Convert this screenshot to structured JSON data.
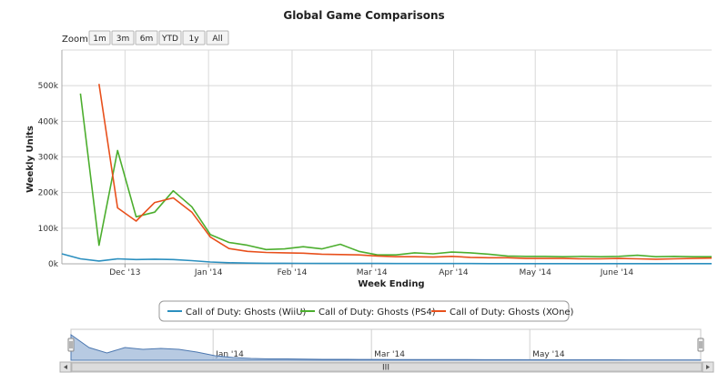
{
  "chart_data": {
    "type": "line",
    "title": "Global Game Comparisons",
    "xlabel": "Week Ending",
    "ylabel": "Weekly Units",
    "y_ticks": [
      "0k",
      "100k",
      "200k",
      "300k",
      "400k",
      "500k"
    ],
    "ylim": [
      0,
      600000
    ],
    "x_ticks": [
      "Dec '13",
      "Jan '14",
      "Feb '14",
      "Mar '14",
      "Apr '14",
      "May '14",
      "June '14"
    ],
    "x_tick_positions": [
      3.4,
      7.9,
      12.4,
      16.7,
      21.1,
      25.5,
      29.9
    ],
    "xlim": [
      0,
      35
    ],
    "grid": true,
    "legend_position": "bottom",
    "series": [
      {
        "name": "Call of Duty: Ghosts (WiiU)",
        "color": "#2b8fbf",
        "points": [
          [
            0,
            28000
          ],
          [
            1,
            14000
          ],
          [
            2,
            8000
          ],
          [
            3,
            14000
          ],
          [
            4,
            12000
          ],
          [
            5,
            13000
          ],
          [
            6,
            12000
          ],
          [
            7,
            9000
          ],
          [
            8,
            5000
          ],
          [
            9,
            3000
          ],
          [
            10,
            2000
          ],
          [
            11,
            1500
          ],
          [
            12,
            1500
          ],
          [
            13,
            1200
          ],
          [
            14,
            1000
          ],
          [
            15,
            1000
          ],
          [
            16,
            900
          ],
          [
            17,
            900
          ],
          [
            18,
            800
          ],
          [
            19,
            800
          ],
          [
            20,
            700
          ],
          [
            21,
            700
          ],
          [
            22,
            700
          ],
          [
            23,
            600
          ],
          [
            24,
            600
          ],
          [
            25,
            600
          ],
          [
            26,
            500
          ],
          [
            27,
            500
          ],
          [
            28,
            500
          ],
          [
            29,
            500
          ],
          [
            30,
            500
          ],
          [
            31,
            400
          ],
          [
            32,
            400
          ],
          [
            33,
            400
          ],
          [
            34,
            400
          ],
          [
            35,
            400
          ]
        ]
      },
      {
        "name": "Call of Duty: Ghosts (PS4)",
        "color": "#4cae2e",
        "points": [
          [
            1,
            478000
          ],
          [
            2,
            52000
          ],
          [
            3,
            318000
          ],
          [
            4,
            132000
          ],
          [
            5,
            145000
          ],
          [
            6,
            205000
          ],
          [
            7,
            160000
          ],
          [
            8,
            82000
          ],
          [
            9,
            60000
          ],
          [
            10,
            52000
          ],
          [
            11,
            40000
          ],
          [
            12,
            42000
          ],
          [
            13,
            48000
          ],
          [
            14,
            42000
          ],
          [
            15,
            55000
          ],
          [
            16,
            35000
          ],
          [
            17,
            25000
          ],
          [
            18,
            25000
          ],
          [
            19,
            31000
          ],
          [
            20,
            28000
          ],
          [
            21,
            33000
          ],
          [
            22,
            31000
          ],
          [
            23,
            27000
          ],
          [
            24,
            22000
          ],
          [
            25,
            21000
          ],
          [
            26,
            21000
          ],
          [
            27,
            20000
          ],
          [
            28,
            21000
          ],
          [
            29,
            20000
          ],
          [
            30,
            21000
          ],
          [
            31,
            24000
          ],
          [
            32,
            20000
          ],
          [
            33,
            21000
          ],
          [
            34,
            20000
          ],
          [
            35,
            20000
          ]
        ]
      },
      {
        "name": "Call of Duty: Ghosts (XOne)",
        "color": "#e8501c",
        "points": [
          [
            2,
            505000
          ],
          [
            3,
            157000
          ],
          [
            4,
            120000
          ],
          [
            5,
            172000
          ],
          [
            6,
            185000
          ],
          [
            7,
            145000
          ],
          [
            8,
            75000
          ],
          [
            9,
            43000
          ],
          [
            10,
            35000
          ],
          [
            11,
            32000
          ],
          [
            12,
            31000
          ],
          [
            13,
            30000
          ],
          [
            14,
            27000
          ],
          [
            15,
            26000
          ],
          [
            16,
            25000
          ],
          [
            17,
            22000
          ],
          [
            18,
            20000
          ],
          [
            19,
            20000
          ],
          [
            20,
            19000
          ],
          [
            21,
            21000
          ],
          [
            22,
            18000
          ],
          [
            23,
            17000
          ],
          [
            24,
            17000
          ],
          [
            25,
            15000
          ],
          [
            26,
            15000
          ],
          [
            27,
            15000
          ],
          [
            28,
            14000
          ],
          [
            29,
            14000
          ],
          [
            30,
            15000
          ],
          [
            31,
            14000
          ],
          [
            32,
            13000
          ],
          [
            33,
            14000
          ],
          [
            34,
            15000
          ],
          [
            35,
            16000
          ]
        ]
      }
    ]
  },
  "zoom": {
    "label": "Zoom",
    "buttons": [
      "1m",
      "3m",
      "6m",
      "YTD",
      "1y",
      "All"
    ]
  },
  "navigator": {
    "ticks": [
      "Jan '14",
      "Mar '14",
      "May '14"
    ],
    "scroll_grip": "III"
  }
}
